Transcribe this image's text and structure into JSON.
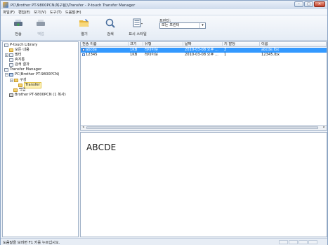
{
  "window": {
    "title": "PC\\Brother PT-9800PCN(복구됨)\\Transfer - P-touch Transfer Manager",
    "buttons": {
      "minimize": "–",
      "maximize": "□",
      "close": "✕"
    }
  },
  "menu": {
    "items": [
      "파일(F)",
      "편집(E)",
      "보기(V)",
      "도구(T)",
      "도움말(H)"
    ]
  },
  "toolbar": {
    "transfer": "전송",
    "backup": "백업",
    "open": "열기",
    "search": "검색",
    "display_style": "표시 스타일",
    "printer_label": "프린터:",
    "printer_value": "모든 프린터"
  },
  "tree": {
    "items": [
      {
        "label": "P-touch Library"
      },
      {
        "label": "모든 내용"
      },
      {
        "label": "필터"
      },
      {
        "label": "휴지통"
      },
      {
        "label": "검색 결과"
      },
      {
        "label": "Transfer Manager"
      },
      {
        "label": "PC(Brother PT-9800PCN)"
      },
      {
        "label": "구성"
      },
      {
        "label": "Transfer"
      },
      {
        "label": "백업"
      },
      {
        "label": "Brother PT-9800PCN (1 복사)"
      }
    ]
  },
  "list": {
    "columns": [
      "전송 이름",
      "크기",
      "유형",
      "날짜",
      "키 할당",
      "이름"
    ],
    "rows": [
      [
        "abcde",
        "1KB",
        "레이아웃",
        "2010-03-08 오후 ...",
        "2",
        "abcde.lbx"
      ],
      [
        "12345",
        "1KB",
        "레이아웃",
        "2010-03-08 오후 ...",
        "1",
        "12345.lbx"
      ]
    ],
    "selected_row": 0
  },
  "preview": {
    "text": "ABCDE"
  },
  "status": {
    "text": "도움말을 보려면 F1 키를 누르십시오."
  },
  "colors": {
    "selection": "#3399ff",
    "accent": "#3a7bd5"
  }
}
